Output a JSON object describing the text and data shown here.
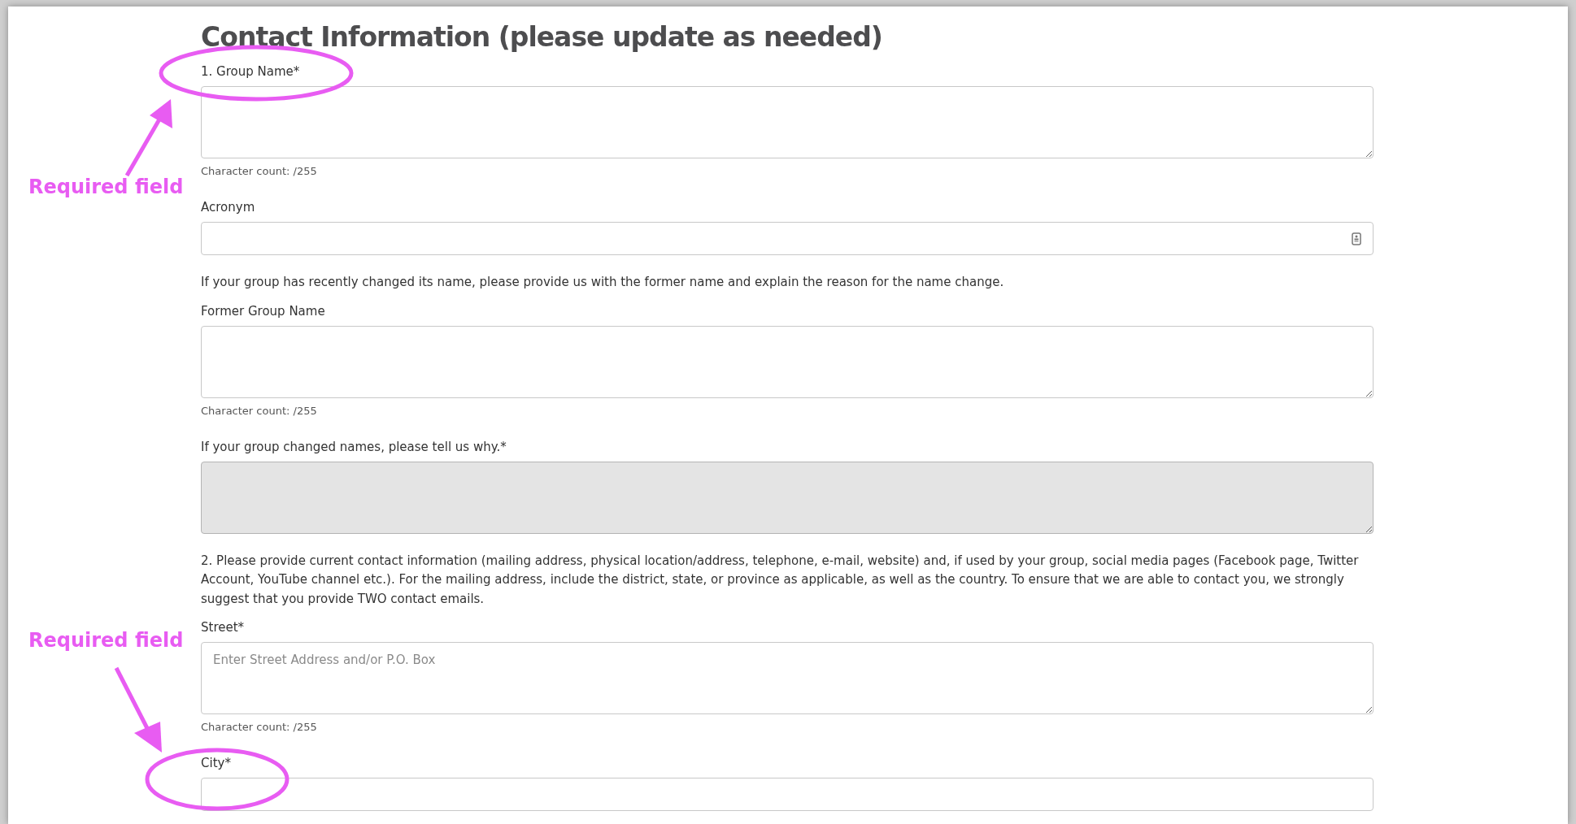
{
  "heading": "Contact Information (please update as needed)",
  "items": [
    {
      "kind": "field",
      "label": "1. Group Name*",
      "control": {
        "kind": "textarea"
      },
      "disabled": false,
      "counter": "Character count: /255"
    },
    {
      "kind": "field",
      "label": "Acronym",
      "control": {
        "kind": "input"
      },
      "disabled": false,
      "autofill_icon": true
    },
    {
      "kind": "note",
      "text": "If your group has recently changed its name, please provide us with the former name and explain the reason for the name change."
    },
    {
      "kind": "field",
      "label": "Former Group Name",
      "control": {
        "kind": "textarea"
      },
      "disabled": false,
      "counter": "Character count: /255"
    },
    {
      "kind": "field",
      "label": "If your group changed names, please tell us why.*",
      "control": {
        "kind": "textarea"
      },
      "disabled": true
    },
    {
      "kind": "note",
      "text": "2. Please provide current contact information (mailing address, physical location/address, telephone, e-mail, website) and, if used by your group, social media pages (Facebook page, Twitter Account, YouTube channel etc.). For the mailing address, include the district, state, or province as applicable, as well as the country. To ensure that we are able to contact you, we strongly suggest that you provide TWO contact emails."
    },
    {
      "kind": "field",
      "label": "Street*",
      "control": {
        "kind": "textarea"
      },
      "disabled": false,
      "placeholder": "Enter Street Address and/or P.O. Box",
      "counter": "Character count: /255"
    },
    {
      "kind": "field",
      "label": "City*",
      "control": {
        "kind": "input"
      },
      "disabled": false
    }
  ],
  "annotations": [
    {
      "text": "Required field"
    },
    {
      "text": "Required field"
    }
  ]
}
